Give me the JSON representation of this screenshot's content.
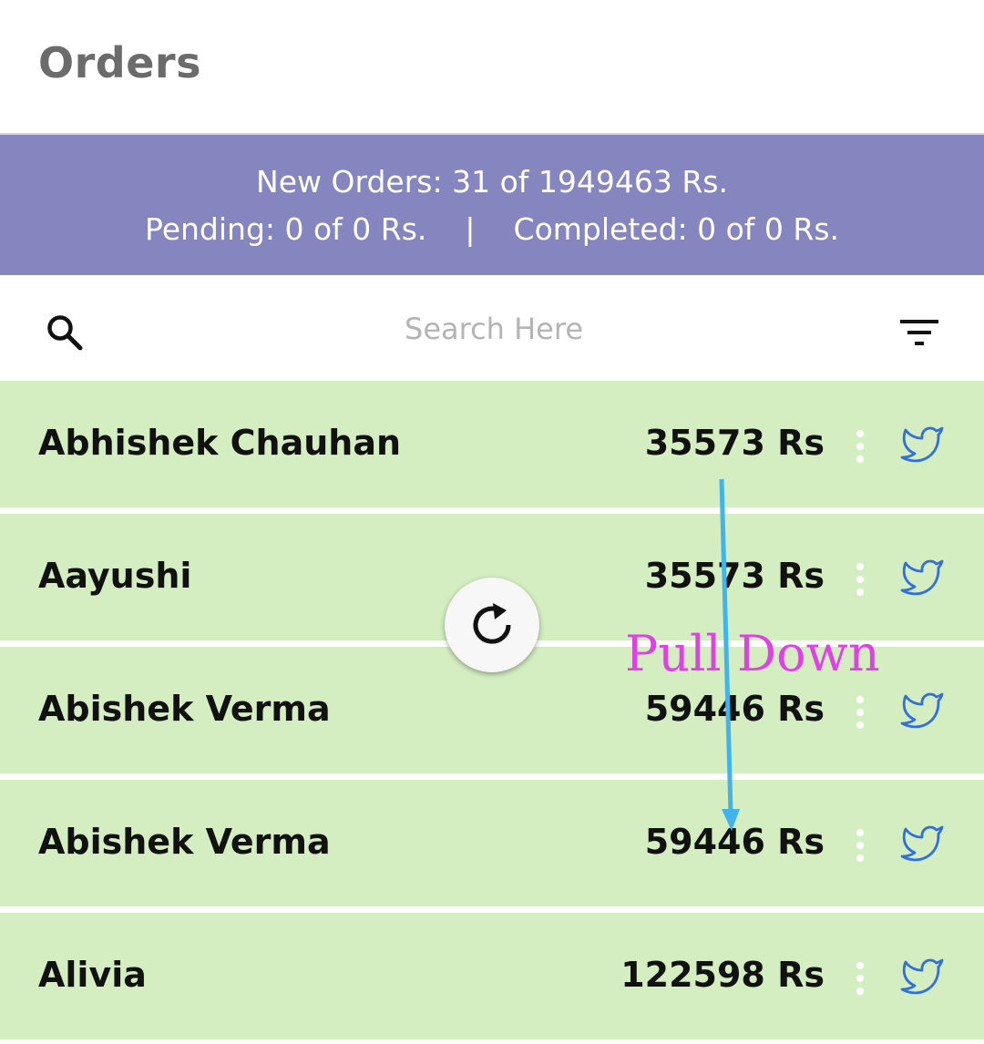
{
  "header": {
    "title": "Orders"
  },
  "summary": {
    "new_orders": "New Orders: 31 of 1949463 Rs.",
    "pending": "Pending: 0 of 0 Rs.",
    "separator": "|",
    "completed": "Completed: 0 of 0 Rs."
  },
  "search": {
    "placeholder": "Search Here",
    "icon": "search-icon",
    "filter_icon": "filter-icon"
  },
  "orders": [
    {
      "name": "Abhishek Chauhan",
      "amount": "35573 Rs"
    },
    {
      "name": "Aayushi",
      "amount": "35573 Rs"
    },
    {
      "name": "Abishek Verma",
      "amount": "59446 Rs"
    },
    {
      "name": "Abishek Verma",
      "amount": "59446 Rs"
    },
    {
      "name": "Alivia",
      "amount": "122598 Rs"
    }
  ],
  "row_icons": {
    "menu": "more-vertical-icon",
    "social": "twitter-icon"
  },
  "refresh": {
    "icon": "refresh-icon"
  },
  "annotation": {
    "text": "Pull Down",
    "color": "#e040e6",
    "arrow_color": "#3fb4ef"
  },
  "colors": {
    "summary_bg": "#8585bf",
    "row_bg": "#d4edc1",
    "twitter_blue": "#2f6fe0"
  }
}
